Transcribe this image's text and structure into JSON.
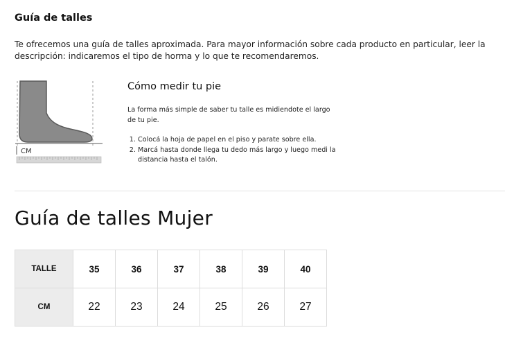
{
  "guide": {
    "heading": "Guía de talles",
    "intro": "Te ofrecemos una guía de talles aproximada. Para mayor información sobre cada producto en particular, leer la descripción: indicaremos el tipo de horma y lo que te recomendaremos."
  },
  "figure": {
    "icon": "foot-measure-icon",
    "unit_label": "CM"
  },
  "measure": {
    "title": "Cómo medir tu pie",
    "description": "La forma más simple de saber tu talle es midiendote el largo de tu pie.",
    "steps": [
      "Colocá la hoja de papel en el piso y parate sobre ella.",
      "Marcá hasta donde llega tu dedo más largo y luego medi la distancia hasta el talón."
    ]
  },
  "size_guide": {
    "title": "Guía de talles Mujer",
    "rows": [
      {
        "header": "TALLE",
        "values": [
          "35",
          "36",
          "37",
          "38",
          "39",
          "40"
        ]
      },
      {
        "header": "CM",
        "values": [
          "22",
          "23",
          "24",
          "25",
          "26",
          "27"
        ]
      }
    ]
  }
}
